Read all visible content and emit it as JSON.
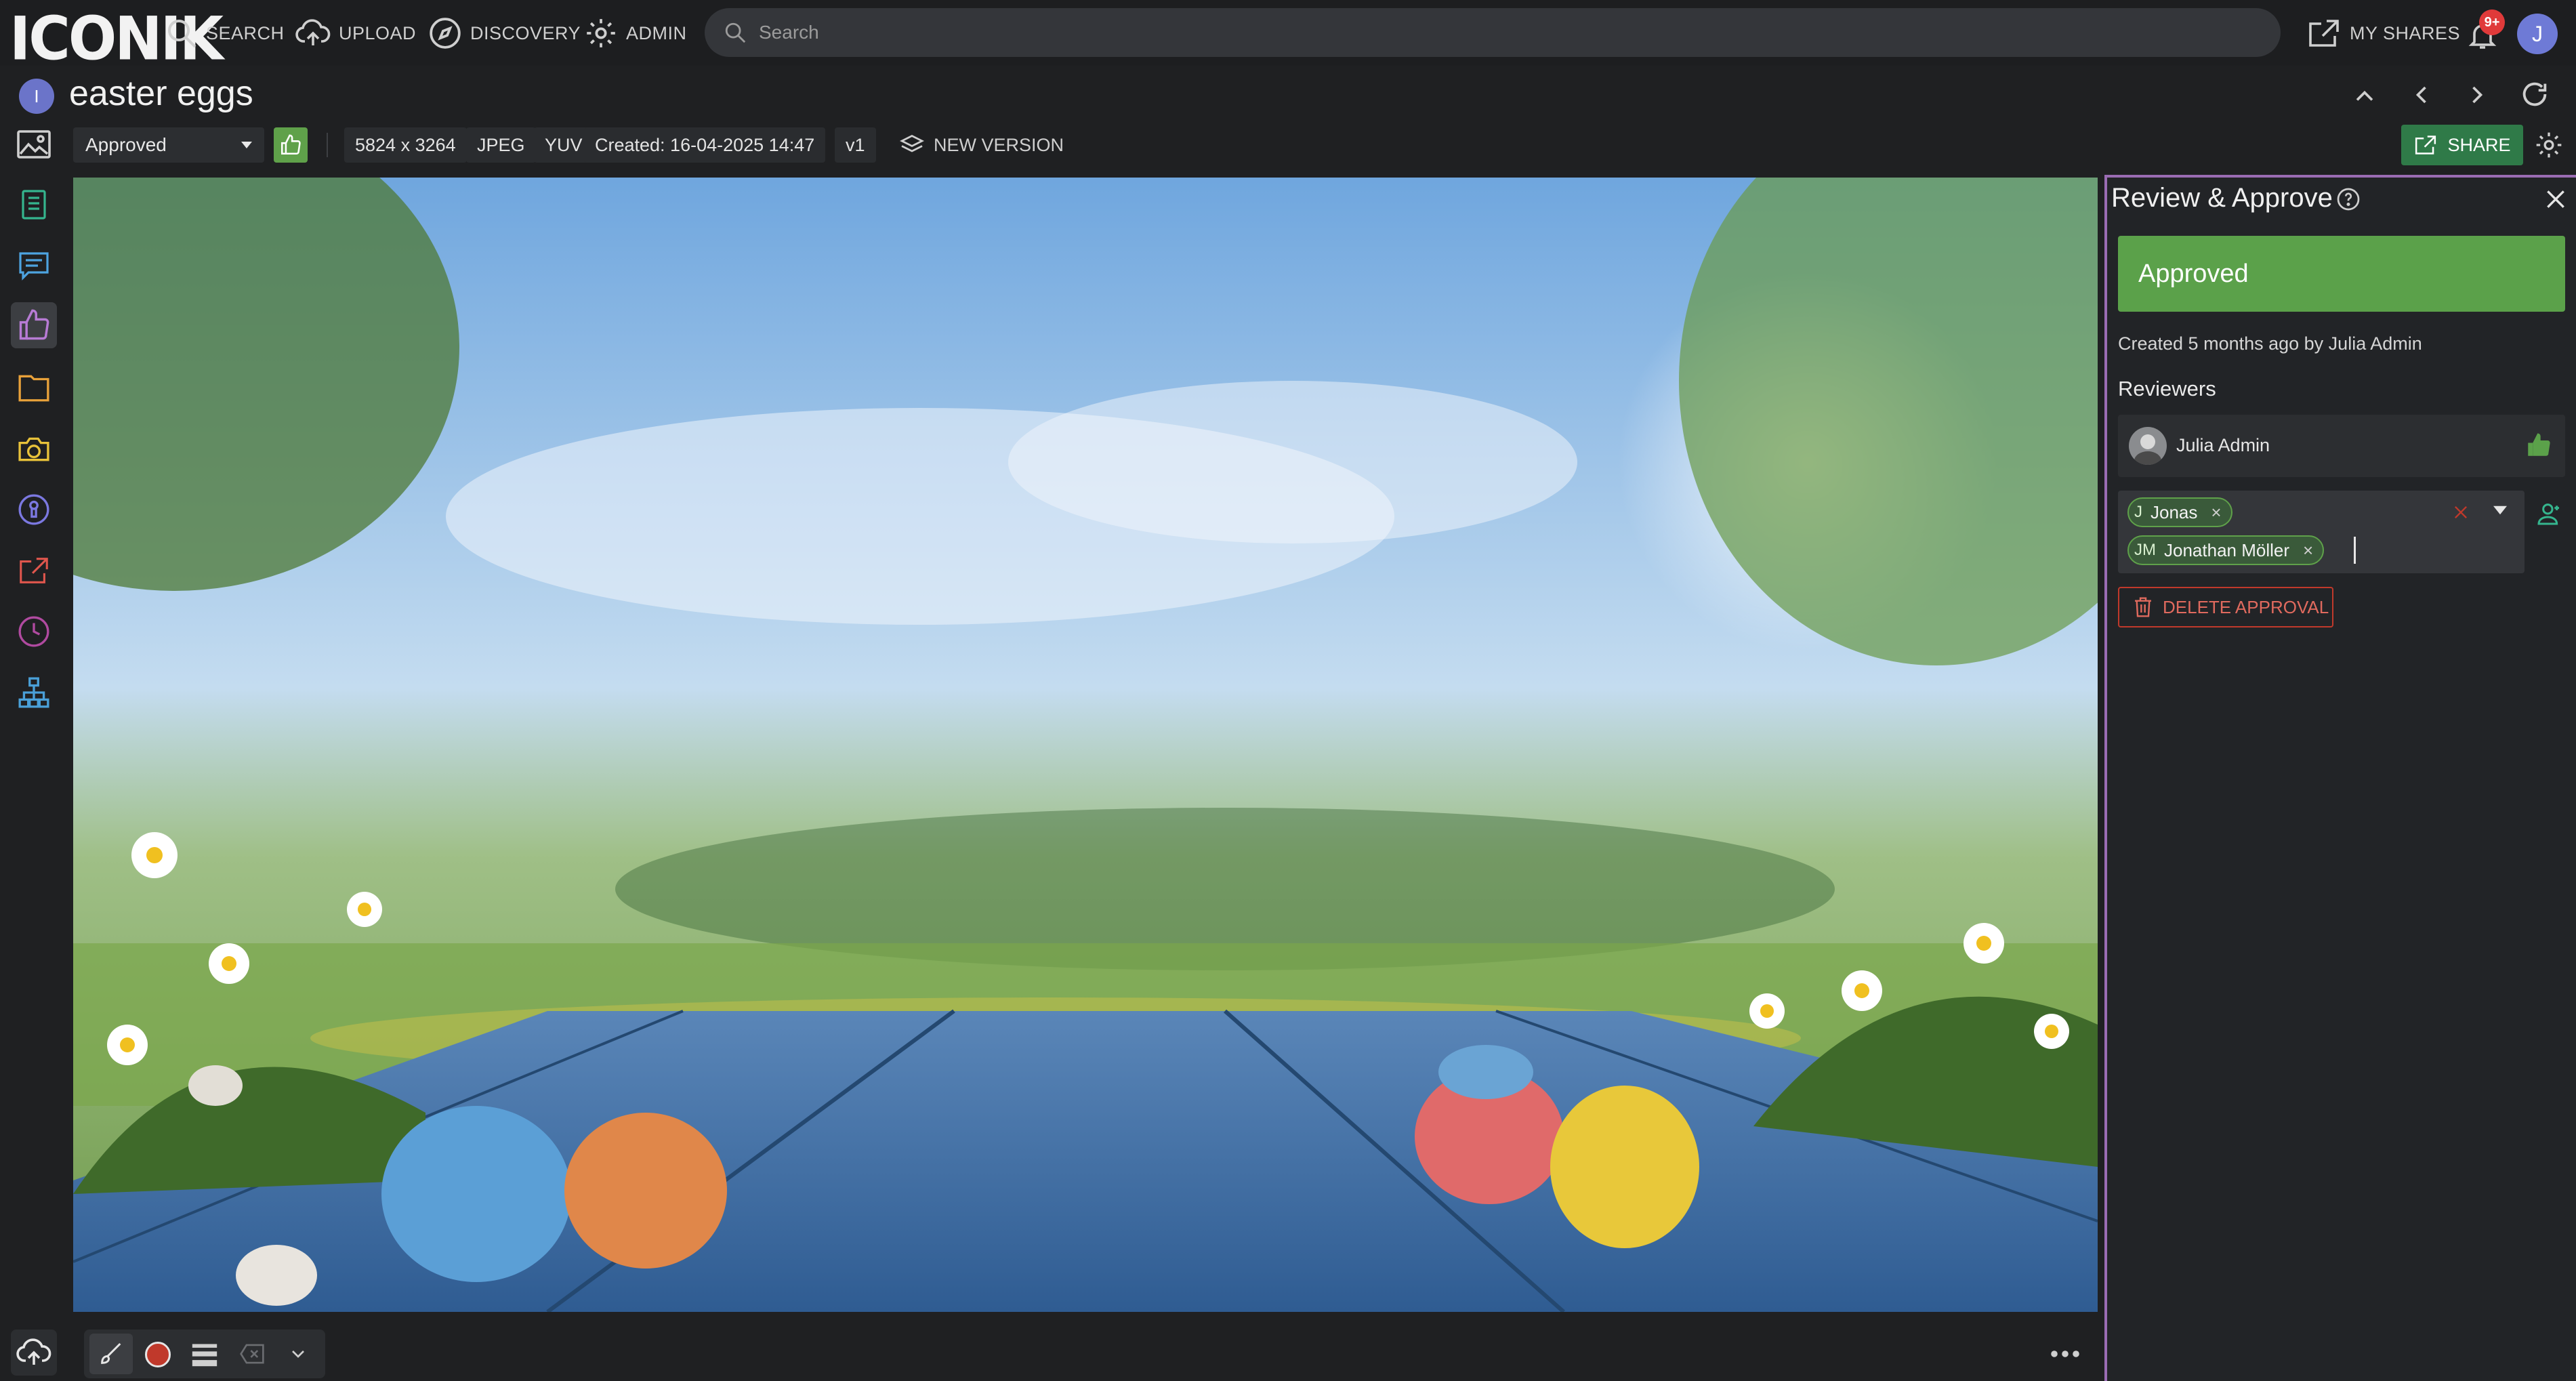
{
  "topbar": {
    "logo": "ICONIK",
    "nav": [
      {
        "label": "SEARCH",
        "icon": "search-icon"
      },
      {
        "label": "UPLOAD",
        "icon": "cloud-upload-icon"
      },
      {
        "label": "DISCOVERY",
        "icon": "compass-icon"
      },
      {
        "label": "ADMIN",
        "icon": "gear-icon"
      }
    ],
    "search_placeholder": "Search",
    "my_shares": "MY SHARES",
    "notification_count": "9+",
    "user_initial": "J"
  },
  "asset": {
    "avatar_initial": "I",
    "title": "easter eggs",
    "status": "Approved",
    "dimensions": "5824 x 3264",
    "format": "JPEG",
    "color_space": "YUV",
    "created": "Created: 16-04-2025 14:47",
    "version": "v1",
    "new_version": "NEW VERSION",
    "share": "SHARE"
  },
  "panel": {
    "title": "Review & Approve",
    "status_banner": "Approved",
    "created_line": "Created 5 months ago by  Julia Admin",
    "reviewers_title": "Reviewers",
    "reviewer_name": "Julia Admin",
    "chips": [
      {
        "initials": "J",
        "name": "Jonas"
      },
      {
        "initials": "JM",
        "name": "Jonathan Möller"
      }
    ],
    "delete_label": "DELETE APPROVAL"
  },
  "colors": {
    "accent_green": "#5ba14a",
    "panel_border": "#9a6cb3",
    "danger": "#c0392b"
  }
}
